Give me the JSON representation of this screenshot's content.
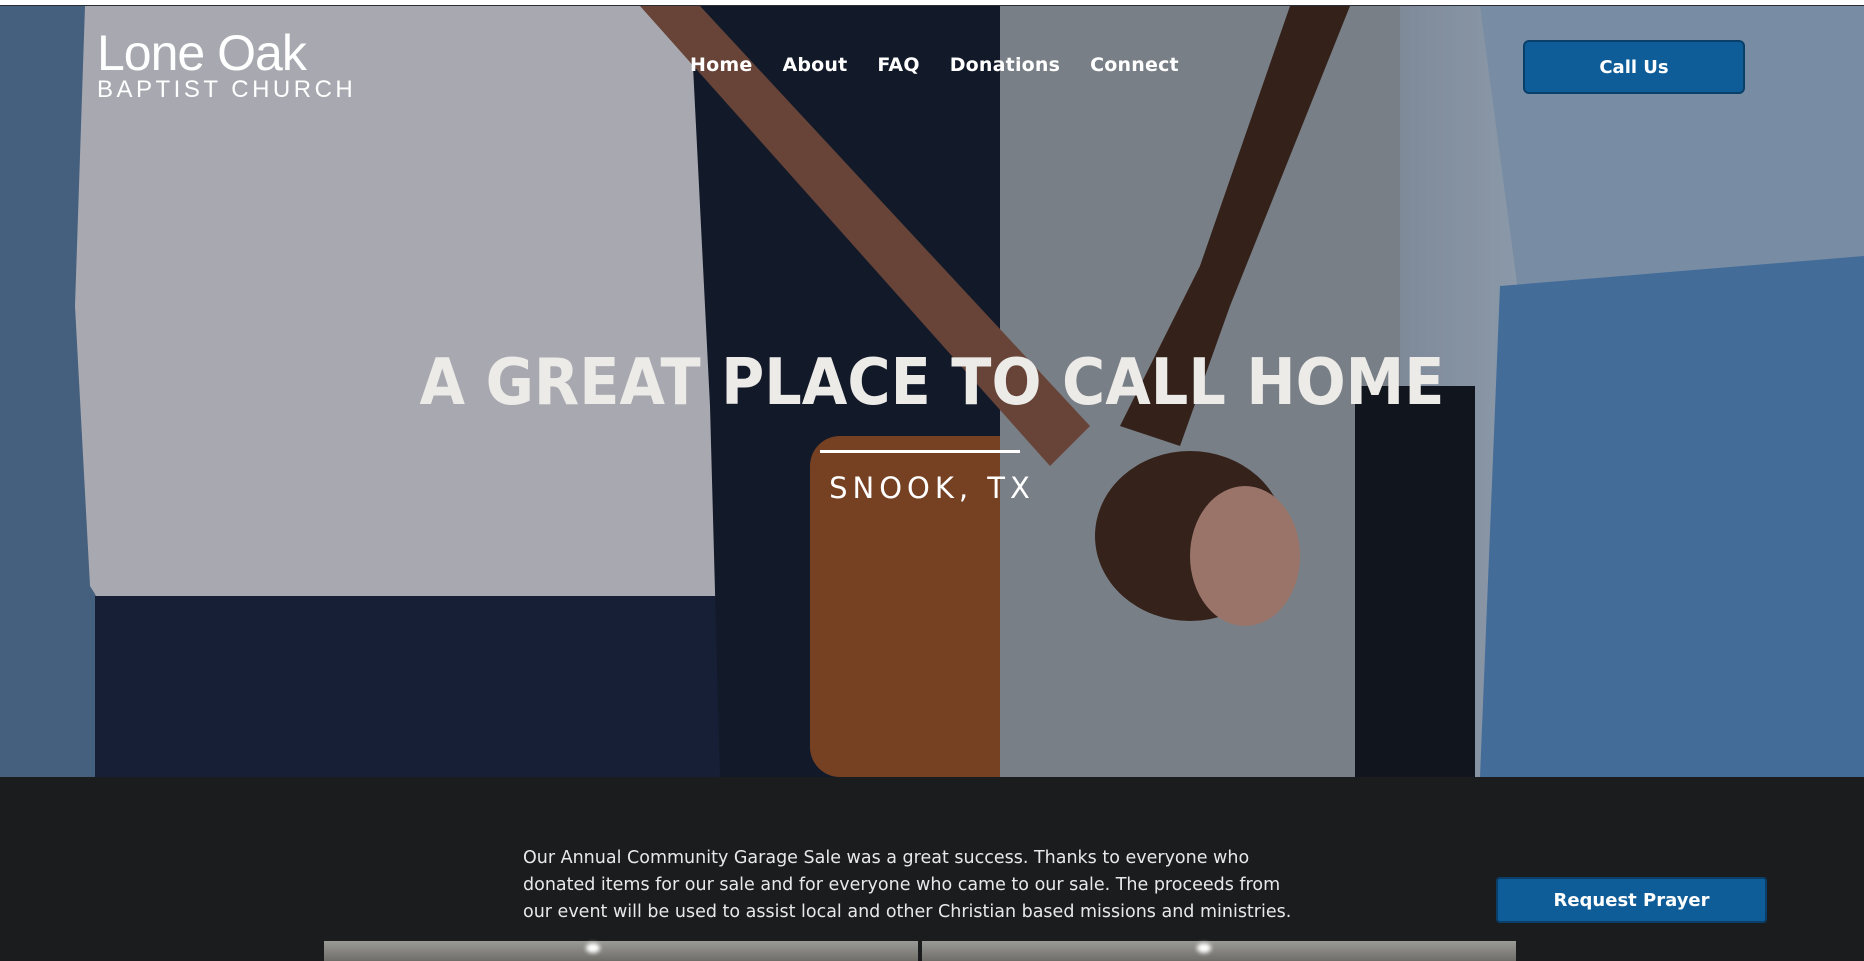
{
  "brand": {
    "name": "Lone Oak",
    "subtitle": "BAPTIST CHURCH"
  },
  "nav": {
    "items": [
      {
        "label": "Home"
      },
      {
        "label": "About"
      },
      {
        "label": "FAQ"
      },
      {
        "label": "Donations"
      },
      {
        "label": "Connect"
      }
    ]
  },
  "header": {
    "call_label": "Call Us"
  },
  "hero": {
    "headline": "A GREAT PLACE TO CALL HOME",
    "location": "SNOOK, TX"
  },
  "content": {
    "announcement": "Our Annual Community Garage Sale was a great success. Thanks to everyone who donated items for our sale and for everyone who came to our sale. The proceeds from our event will be used to assist local and other Christian based missions and ministries."
  },
  "actions": {
    "prayer_label": "Request Prayer"
  },
  "colors": {
    "accent": "#0f5d98",
    "background": "#1b1c1e"
  }
}
